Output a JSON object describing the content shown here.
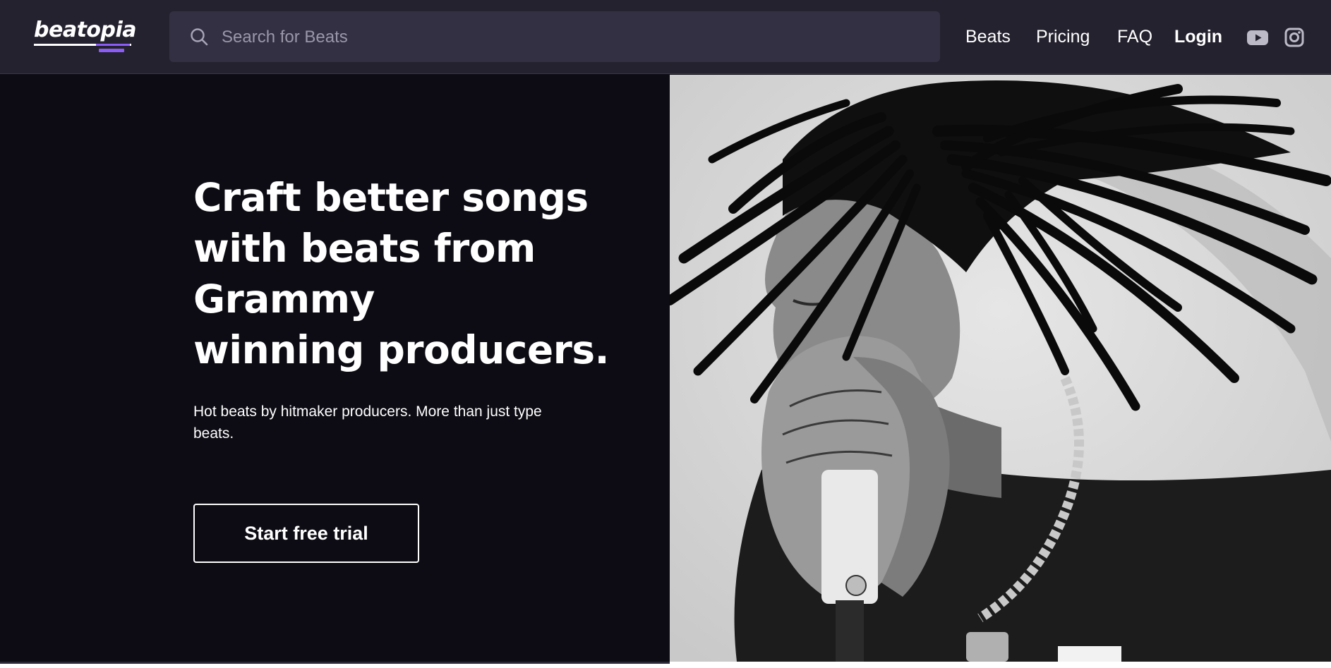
{
  "header": {
    "logo_text": "beatopia",
    "search": {
      "placeholder": "Search for Beats",
      "value": ""
    },
    "nav": {
      "beats": "Beats",
      "pricing": "Pricing",
      "faq": "FAQ",
      "login": "Login"
    },
    "social": [
      "youtube-icon",
      "instagram-icon"
    ]
  },
  "hero": {
    "headline": [
      "Craft better songs",
      "with beats from",
      "Grammy",
      "winning producers."
    ],
    "subheadline": "Hot beats by hitmaker producers. More than just type beats.",
    "cta_label": "Start free trial"
  },
  "colors": {
    "header_bg": "#25222f",
    "search_bg": "#333043",
    "hero_bg": "#0d0c14",
    "accent": "#8b5cf6",
    "text": "#ffffff"
  }
}
